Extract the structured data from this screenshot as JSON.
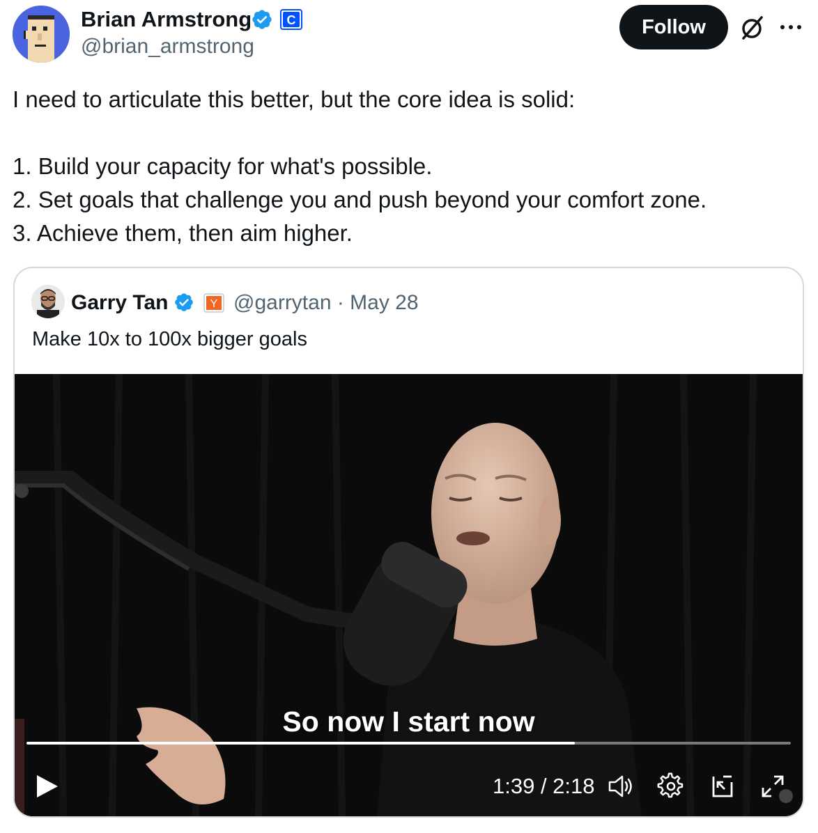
{
  "author": {
    "name": "Brian Armstrong",
    "handle": "@brian_armstrong",
    "affiliate_badge_letter": "C"
  },
  "actions": {
    "follow_label": "Follow"
  },
  "tweet": {
    "intro": "I need to articulate this better, but the core idea is solid:",
    "points": [
      "1. Build your capacity for what's possible.",
      "2. Set goals that challenge you and push beyond your comfort zone.",
      "3. Achieve them, then aim higher."
    ]
  },
  "quote": {
    "name": "Garry Tan",
    "handle_date": "@garrytan · May 28",
    "affiliate_badge_letter": "Y",
    "text": "Make 10x to 100x bigger goals"
  },
  "video": {
    "caption": "So now I start now",
    "time": "1:39 / 2:18",
    "progress_fraction": 0.717
  },
  "colors": {
    "accent_verified": "#1d9bf0",
    "follow_bg": "#0f1419",
    "coinbase_blue": "#0052ff",
    "yc_orange": "#f26522"
  }
}
